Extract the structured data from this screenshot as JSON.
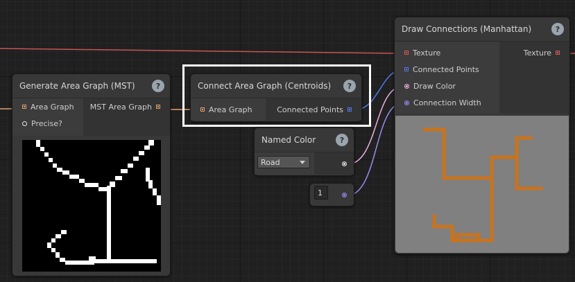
{
  "nodes": {
    "generate_area_graph": {
      "title": "Generate Area Graph (MST)",
      "inputs": [
        "Area Graph",
        "Precise?"
      ],
      "output": "MST Area Graph"
    },
    "connect_area_graph": {
      "title": "Connect Area Graph (Centroids)",
      "input": "Area Graph",
      "output": "Connected Points"
    },
    "named_color": {
      "title": "Named Color",
      "selected_value": "Road"
    },
    "width_value": {
      "value": "1"
    },
    "draw_connections": {
      "title": "Draw Connections (Manhattan)",
      "inputs": [
        "Texture",
        "Connected Points",
        "Draw Color",
        "Connection Width"
      ],
      "output": "Texture"
    }
  },
  "help_glyph": "?",
  "colors": {
    "texture_wire": "#d55a5a",
    "area_graph_wire": "#e3a070",
    "points_wire": "#5577ee",
    "color_wire": "#f0b0e0",
    "width_wire": "#9a8cf5",
    "road_color": "#c8731e",
    "highlight": "#ffffff"
  }
}
